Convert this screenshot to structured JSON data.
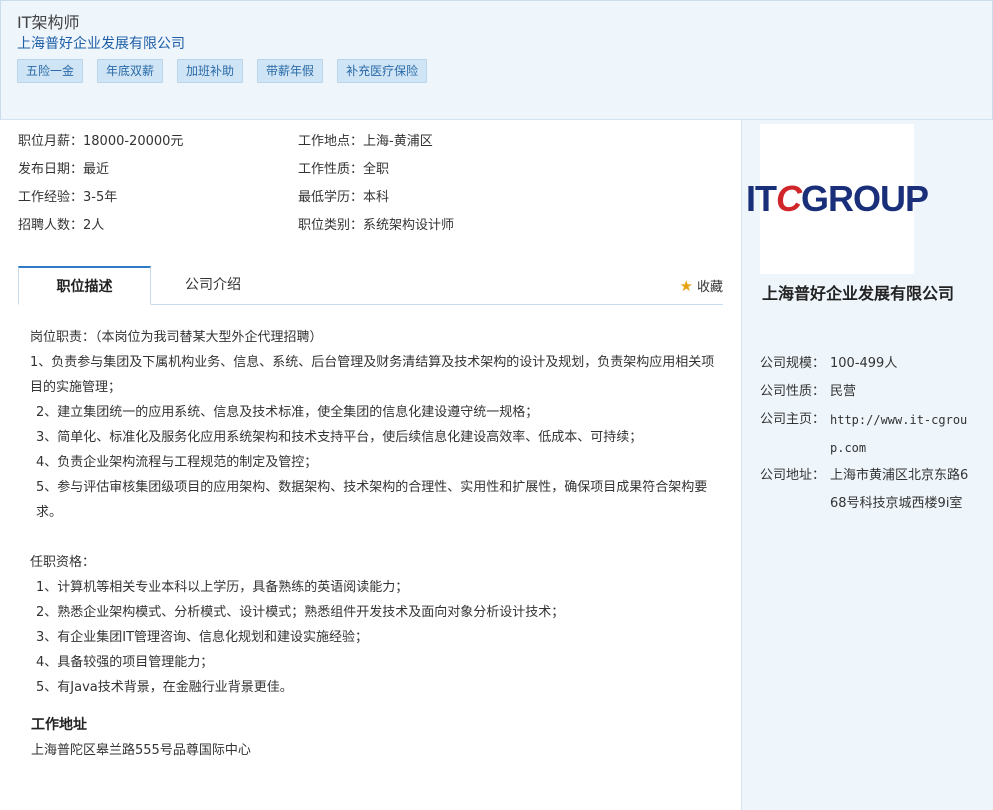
{
  "header": {
    "job_title": "IT架构师",
    "company": "上海普好企业发展有限公司",
    "tags": [
      "五险一金",
      "年底双薪",
      "加班补助",
      "带薪年假",
      "补充医疗保险"
    ]
  },
  "info": {
    "salary": "职位月薪：18000-20000元",
    "location": "工作地点：上海-黄浦区",
    "publish_date": "发布日期：最近",
    "job_type": "工作性质：全职",
    "experience": "工作经验：3-5年",
    "education": "最低学历：本科",
    "headcount": "招聘人数：2人",
    "category": "职位类别：系统架构设计师"
  },
  "tabs": {
    "description": "职位描述",
    "company_intro": "公司介绍",
    "favorite": "收藏"
  },
  "description": {
    "duties_title": "岗位职责：（本岗位为我司替某大型外企代理招聘）",
    "duties": [
      "1、负责参与集团及下属机构业务、信息、系统、后台管理及财务清结算及技术架构的设计及规划，负责架构应用相关项目的实施管理；",
      "2、建立集团统一的应用系统、信息及技术标准，使全集团的信息化建设遵守统一规格；",
      "3、简单化、标准化及服务化应用系统架构和技术支持平台，使后续信息化建设高效率、低成本、可持续；",
      "4、负责企业架构流程与工程规范的制定及管控；",
      "5、参与评估审核集团级项目的应用架构、数据架构、技术架构的合理性、实用性和扩展性，确保项目成果符合架构要求。"
    ],
    "req_title": "任职资格：",
    "requirements": [
      "1、计算机等相关专业本科以上学历，具备熟练的英语阅读能力；",
      "2、熟悉企业架构模式、分析模式、设计模式；熟悉组件开发技术及面向对象分析设计技术；",
      "3、有企业集团IT管理咨询、信息化规划和建设实施经验；",
      "4、具备较强的项目管理能力；",
      "5、有Java技术背景，在金融行业背景更佳。"
    ],
    "address_title": "工作地址",
    "address": "上海普陀区皋兰路555号品尊国际中心"
  },
  "sidebar": {
    "logo_it": "IT",
    "logo_c": "C",
    "logo_group": "GROUP",
    "company_name": "上海普好企业发展有限公司",
    "size_label": "公司规模：",
    "size": "100-499人",
    "nature_label": "公司性质：",
    "nature": "民营",
    "homepage_label": "公司主页：",
    "homepage": "http://www.it-cgroup.com",
    "address_label": "公司地址：",
    "address": "上海市黄浦区北京东路668号科技京城西楼9i室"
  },
  "colors": {
    "accent": "#2f7bc6",
    "link": "#1f5fa8",
    "tag_bg": "#cfe4f4",
    "panel_bg": "#eef5fb"
  }
}
